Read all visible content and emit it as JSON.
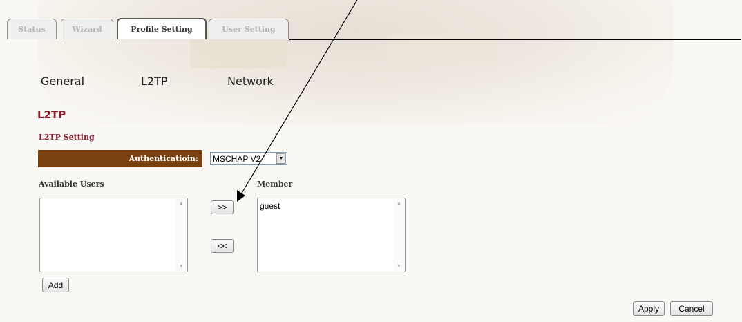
{
  "tabs": [
    {
      "label": "Status",
      "active": false
    },
    {
      "label": "Wizard",
      "active": false
    },
    {
      "label": "Profile Setting",
      "active": true
    },
    {
      "label": "User Setting",
      "active": false
    }
  ],
  "subnav": {
    "general": "General",
    "l2tp": "L2TP",
    "network": "Network"
  },
  "section": {
    "title": "L2TP",
    "subtitle": "L2TP Setting"
  },
  "authentication": {
    "label": "Authenticatioin:",
    "selected": "MSCHAP V2"
  },
  "available_users": {
    "label": "Available Users",
    "items": []
  },
  "member": {
    "label": "Member",
    "items": [
      "guest"
    ]
  },
  "buttons": {
    "move_right": ">>",
    "move_left": "<<",
    "add": "Add",
    "apply": "Apply",
    "cancel": "Cancel"
  },
  "colors": {
    "accent_red": "#8b1a2a",
    "auth_bar_brown": "#7a4110"
  }
}
